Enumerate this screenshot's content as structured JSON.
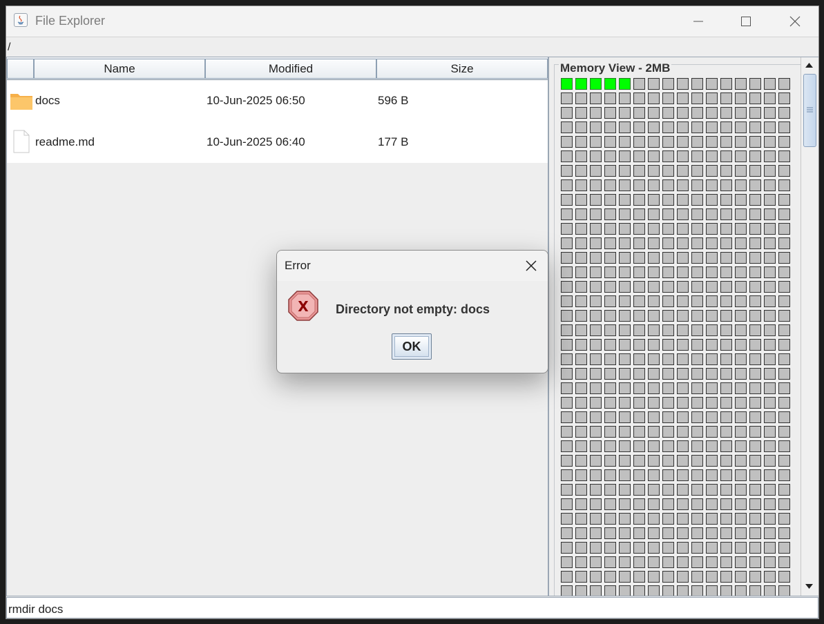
{
  "window": {
    "title": "File Explorer"
  },
  "path": "/",
  "table": {
    "columns": [
      "Name",
      "Modified",
      "Size"
    ],
    "rows": [
      {
        "icon": "folder-icon",
        "name": "docs",
        "modified": "10-Jun-2025 06:50",
        "size": "596 B"
      },
      {
        "icon": "file-icon",
        "name": "readme.md",
        "modified": "10-Jun-2025 06:40",
        "size": "177 B"
      }
    ]
  },
  "memory": {
    "title": "Memory View - 2MB",
    "columns": 16,
    "used_blocks": 5,
    "colors": {
      "used": "#00ff00",
      "free": "#c0c0c0"
    }
  },
  "command": "rmdir docs",
  "dialog": {
    "title": "Error",
    "message": "Directory not empty: docs",
    "ok_label": "OK",
    "icon": "error-icon"
  }
}
